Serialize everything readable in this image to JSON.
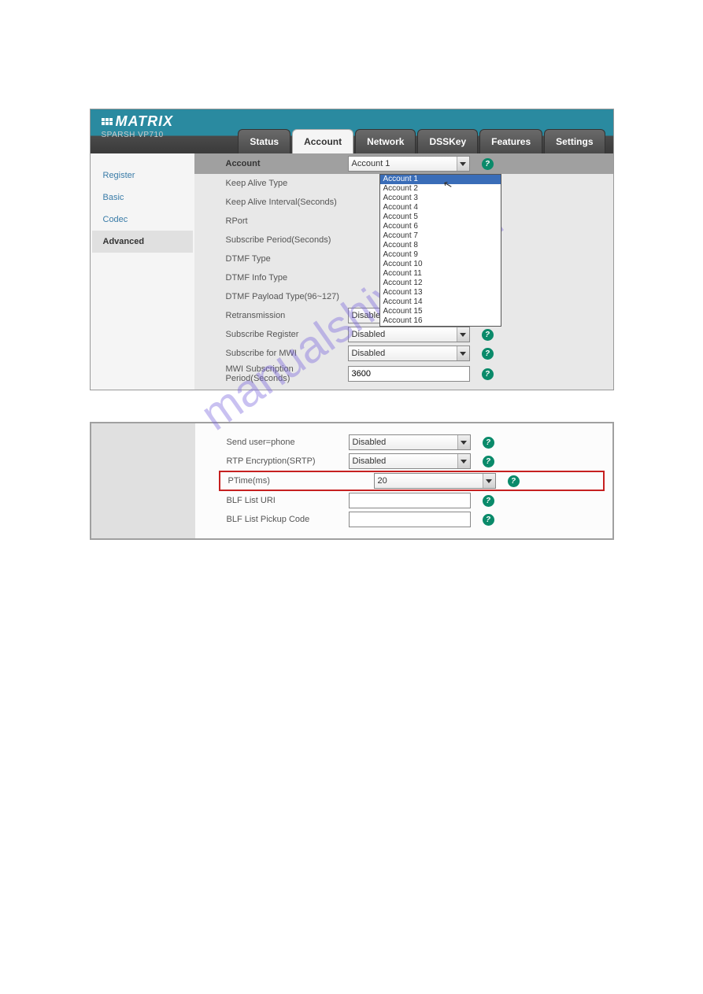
{
  "logo": {
    "brand": "MATRIX",
    "product": "SPARSH VP710"
  },
  "tabs": [
    "Status",
    "Account",
    "Network",
    "DSSKey",
    "Features",
    "Settings"
  ],
  "active_tab": "Account",
  "sidebar": {
    "items": [
      "Register",
      "Basic",
      "Codec",
      "Advanced"
    ],
    "active": "Advanced"
  },
  "panel1": {
    "account_header": "Account",
    "account_selected": "Account 1",
    "dropdown_options": [
      "Account 1",
      "Account 2",
      "Account 3",
      "Account 4",
      "Account 5",
      "Account 6",
      "Account 7",
      "Account 8",
      "Account 9",
      "Account 10",
      "Account 11",
      "Account 12",
      "Account 13",
      "Account 14",
      "Account 15",
      "Account 16"
    ],
    "rows": [
      {
        "label": "Keep Alive Type"
      },
      {
        "label": "Keep Alive Interval(Seconds)"
      },
      {
        "label": "RPort"
      },
      {
        "label": "Subscribe Period(Seconds)"
      },
      {
        "label": "DTMF Type"
      },
      {
        "label": "DTMF Info Type"
      },
      {
        "label": "DTMF Payload Type(96~127)"
      },
      {
        "label": "Retransmission",
        "value": "Disabled",
        "type": "dd"
      },
      {
        "label": "Subscribe Register",
        "value": "Disabled",
        "type": "dd"
      },
      {
        "label": "Subscribe for MWI",
        "value": "Disabled",
        "type": "dd"
      },
      {
        "label": "MWI Subscription Period(Seconds)",
        "value": "3600",
        "type": "txt"
      }
    ]
  },
  "panel2": {
    "rows": [
      {
        "label": "Send user=phone",
        "value": "Disabled",
        "type": "dd"
      },
      {
        "label": "RTP Encryption(SRTP)",
        "value": "Disabled",
        "type": "dd"
      },
      {
        "label": "PTime(ms)",
        "value": "20",
        "type": "dd",
        "highlight": true
      },
      {
        "label": "BLF List URI",
        "value": "",
        "type": "txt"
      },
      {
        "label": "BLF List Pickup Code",
        "value": "",
        "type": "txt"
      }
    ]
  },
  "watermark": "manualshive.com"
}
